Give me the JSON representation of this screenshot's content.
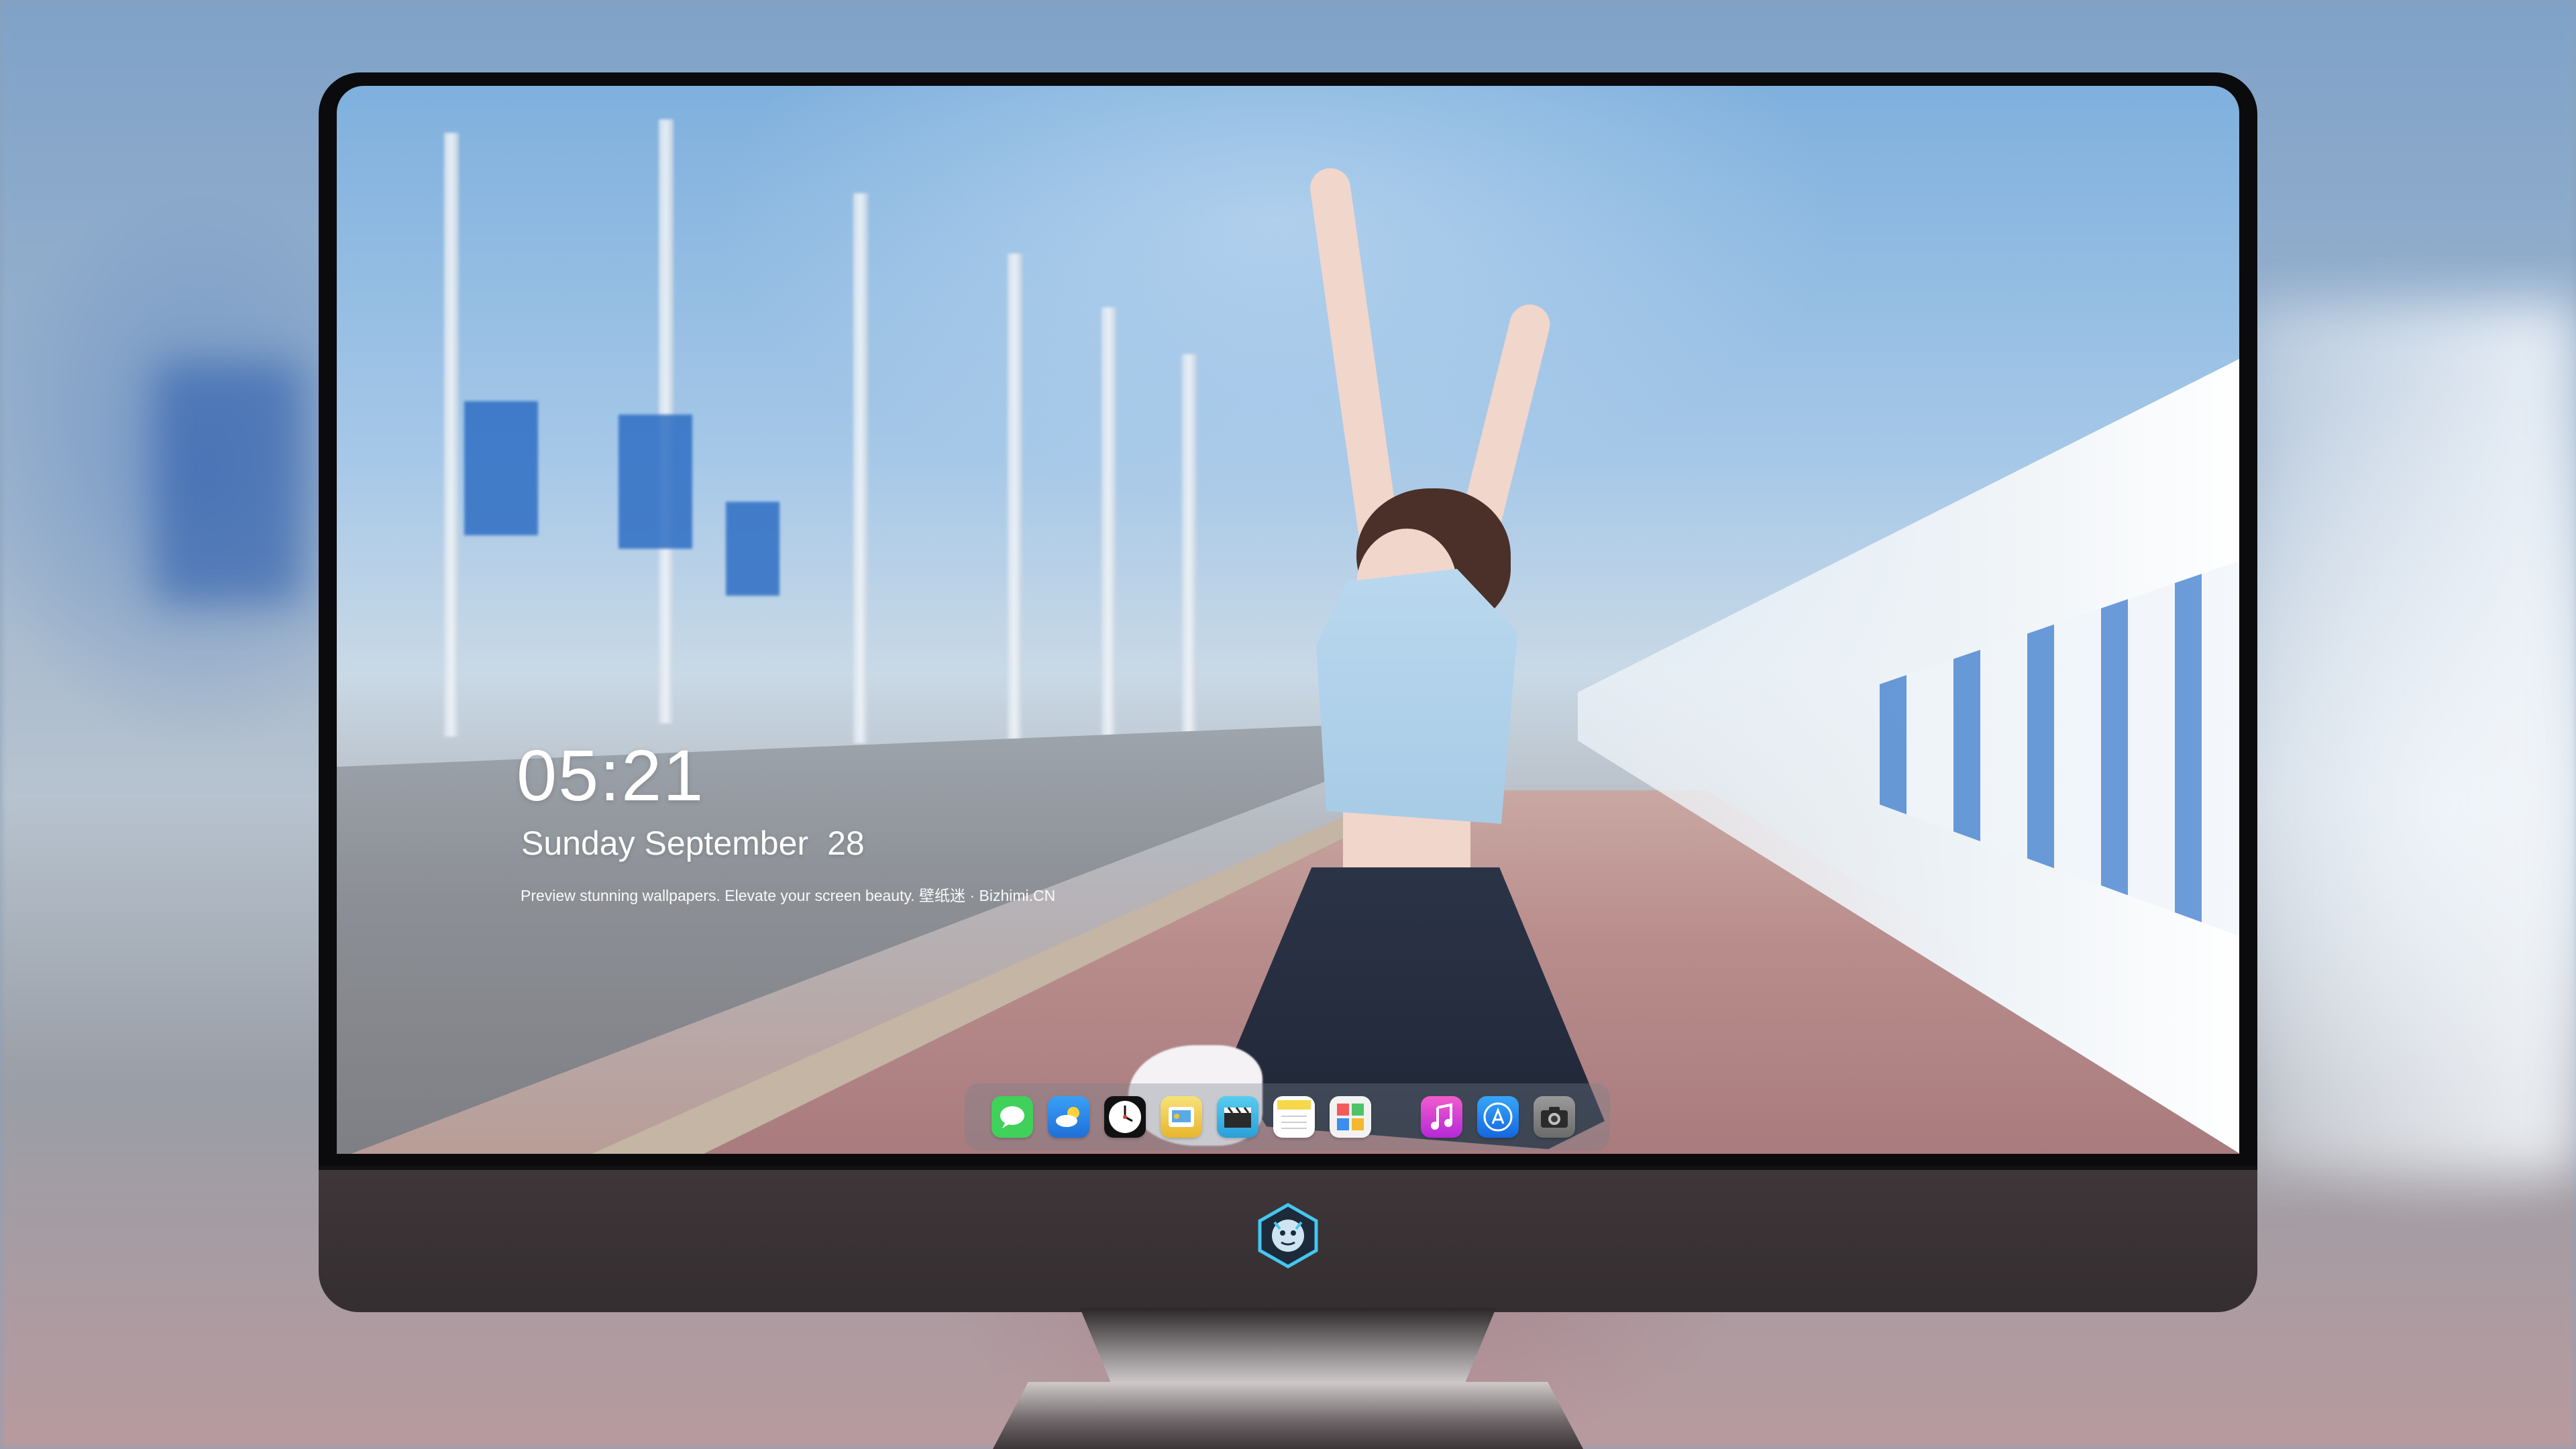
{
  "lock_screen": {
    "time": "05:21",
    "date_weekday_month": "Sunday September",
    "date_day": "28",
    "tagline": "Preview stunning wallpapers. Elevate your screen beauty. 壁纸迷 · Bizhimi.CN"
  },
  "dock": {
    "apps": [
      {
        "name": "messages-icon",
        "color": "#3fd15a"
      },
      {
        "name": "weather-icon",
        "color": "#2c8cf0"
      },
      {
        "name": "clock-icon",
        "color": "#1a1a1a"
      },
      {
        "name": "preview-icon",
        "color": "#f2c230"
      },
      {
        "name": "video-icon",
        "color": "#3ab7e6"
      },
      {
        "name": "notes-icon",
        "color": "#f7d84a"
      },
      {
        "name": "photo-puzzle-icon",
        "color": "#f3f3f3"
      },
      {
        "name": "music-icon",
        "color": "#e040c8"
      },
      {
        "name": "app-store-icon",
        "color": "#1c86f0"
      },
      {
        "name": "camera-icon",
        "color": "#8d8d8d"
      }
    ]
  },
  "colors": {
    "monitor_bezel": "#0b0b0d",
    "monitor_chin": "#3e3638",
    "accent_blue": "#2f6fc4"
  }
}
